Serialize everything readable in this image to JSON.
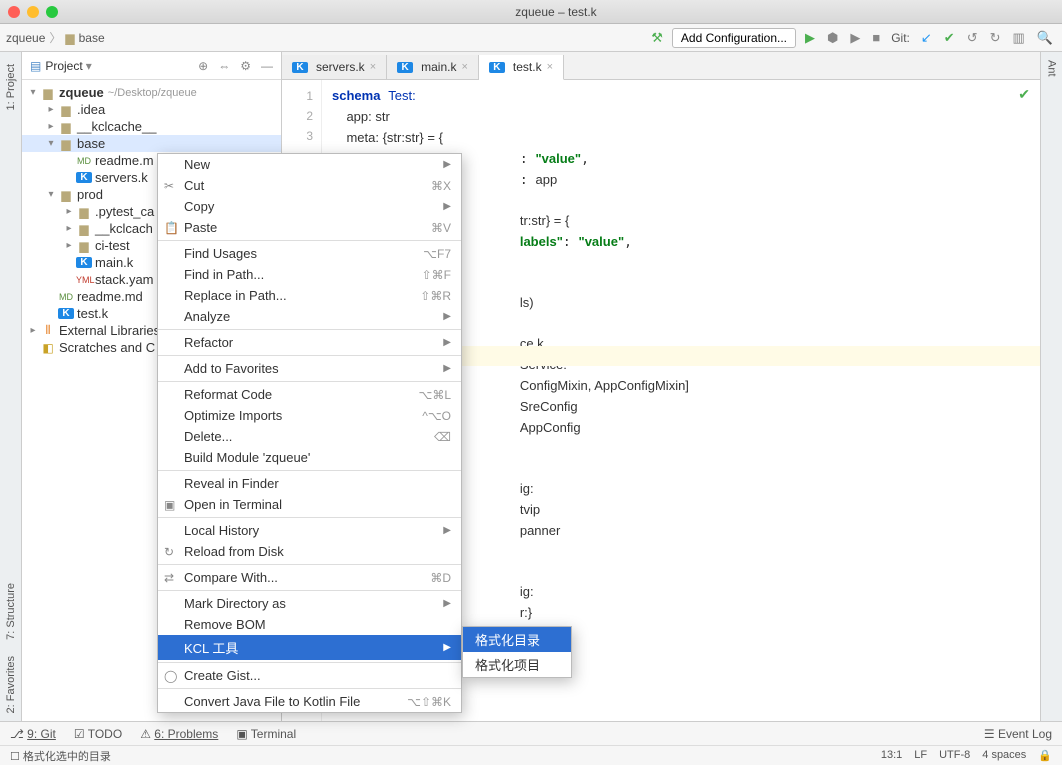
{
  "window": {
    "title": "zqueue – test.k"
  },
  "breadcrumbs": [
    "zqueue",
    "base"
  ],
  "toolbar": {
    "add_config": "Add Configuration...",
    "git_label": "Git:"
  },
  "sidebar": {
    "header": "Project",
    "project_name": "zqueue",
    "project_path": "~/Desktop/zqueue",
    "external_libs": "External Libraries",
    "scratches": "Scratches and C",
    "items": {
      "idea": ".idea",
      "kclcache": "__kclcache__",
      "base": "base",
      "readme_m": "readme.m",
      "servers_k": "servers.k",
      "prod": "prod",
      "pytest_ca": ".pytest_ca",
      "kclcach": "__kclcach",
      "ci_test": "ci-test",
      "main_k": "main.k",
      "stack_yam": "stack.yam",
      "readme_md": "readme.md",
      "test_k": "test.k"
    }
  },
  "tabs": [
    {
      "label": "servers.k",
      "active": false
    },
    {
      "label": "main.k",
      "active": false
    },
    {
      "label": "test.k",
      "active": true
    }
  ],
  "gutter_lines": [
    "1",
    "2",
    "3"
  ],
  "code_visible": {
    "l1_schema": "schema",
    "l1_name": "Test:",
    "l2": "    app: str",
    "l3": "    meta: {str:str} = {",
    "l4_v": "\"value\"",
    "l5": "app",
    "l6": "tr:str} = {",
    "l7_labels": "labels\"",
    "l7_v": "\"value\"",
    "l10": "ls)",
    "l12": "ce.k",
    "l13": "Service:",
    "l14": "ConfigMixin, AppConfigMixin]",
    "l15": "SreConfig",
    "l16": "AppConfig",
    "l18": "ig:",
    "l19": "tvip",
    "l20": "panner",
    "l22": "ig:",
    "l23": "r:}",
    "l24": "tr"
  },
  "context_menu": [
    {
      "label": "New",
      "arrow": true
    },
    {
      "label": "Cut",
      "icon": "✂",
      "shortcut": "⌘X"
    },
    {
      "label": "Copy",
      "arrow": true
    },
    {
      "label": "Paste",
      "icon": "📋",
      "shortcut": "⌘V"
    },
    {
      "sep": true
    },
    {
      "label": "Find Usages",
      "shortcut": "⌥F7"
    },
    {
      "label": "Find in Path...",
      "shortcut": "⇧⌘F"
    },
    {
      "label": "Replace in Path...",
      "shortcut": "⇧⌘R"
    },
    {
      "label": "Analyze",
      "arrow": true
    },
    {
      "sep": true
    },
    {
      "label": "Refactor",
      "arrow": true
    },
    {
      "sep": true
    },
    {
      "label": "Add to Favorites",
      "arrow": true
    },
    {
      "sep": true
    },
    {
      "label": "Reformat Code",
      "shortcut": "⌥⌘L"
    },
    {
      "label": "Optimize Imports",
      "shortcut": "^⌥O"
    },
    {
      "label": "Delete...",
      "shortcut": "⌫"
    },
    {
      "label": "Build Module 'zqueue'"
    },
    {
      "sep": true
    },
    {
      "label": "Reveal in Finder"
    },
    {
      "label": "Open in Terminal",
      "icon": "▣"
    },
    {
      "sep": true
    },
    {
      "label": "Local History",
      "arrow": true
    },
    {
      "label": "Reload from Disk",
      "icon": "↻"
    },
    {
      "sep": true
    },
    {
      "label": "Compare With...",
      "icon": "⇄",
      "shortcut": "⌘D"
    },
    {
      "sep": true
    },
    {
      "label": "Mark Directory as",
      "arrow": true
    },
    {
      "label": "Remove BOM"
    },
    {
      "label": "KCL 工具",
      "arrow": true,
      "selected": true
    },
    {
      "sep": true
    },
    {
      "label": "Create Gist...",
      "icon": "◯"
    },
    {
      "sep": true
    },
    {
      "label": "Convert Java File to Kotlin File",
      "shortcut": "⌥⇧⌘K"
    }
  ],
  "submenu": [
    {
      "label": "格式化目录",
      "selected": true
    },
    {
      "label": "格式化项目"
    }
  ],
  "left_tools": [
    "1: Project",
    "7: Structure",
    "2: Favorites"
  ],
  "right_tools": [
    "Ant"
  ],
  "bottom_tools": {
    "git": "9: Git",
    "todo": "TODO",
    "problems": "6: Problems",
    "terminal": "Terminal",
    "event_log": "Event Log"
  },
  "status": {
    "message": "格式化选中的目录",
    "pos": "13:1",
    "le": "LF",
    "enc": "UTF-8",
    "indent": "4 spaces"
  }
}
